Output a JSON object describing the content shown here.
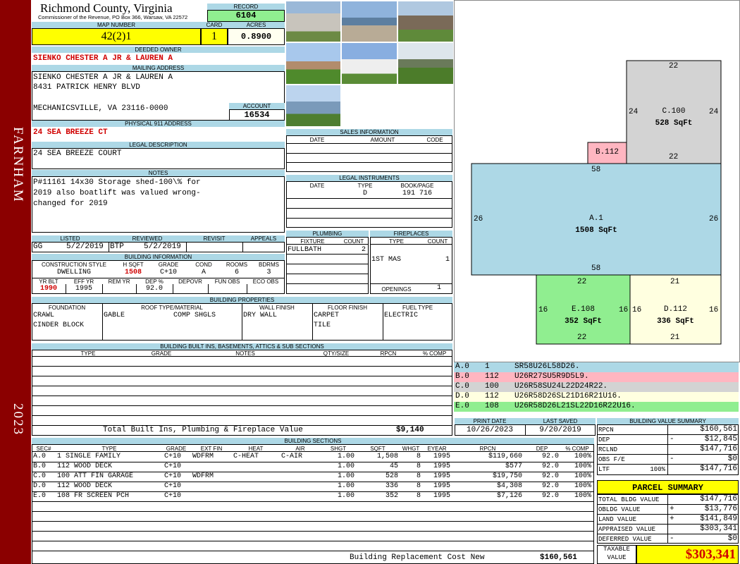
{
  "sidebar": {
    "district": "FARNHAM",
    "year": "2023"
  },
  "header": {
    "county": "Richmond County, Virginia",
    "commissioner": "Commissioner of the Revenue, PO Box 366, Warsaw, VA 22572"
  },
  "record": {
    "label": "RECORD",
    "value": "6104"
  },
  "map_number": {
    "label": "MAP NUMBER",
    "value": "42(2)1"
  },
  "card": {
    "label": "CARD",
    "value": "1"
  },
  "acres": {
    "label": "ACRES",
    "value": "0.8900"
  },
  "deeded_owner": {
    "label": "DEEDED OWNER",
    "value": "SIENKO CHESTER A JR & LAUREN A"
  },
  "mailing": {
    "label": "MAILING ADDRESS",
    "line1": "SIENKO CHESTER A JR & LAUREN A",
    "line2": "8431 PATRICK HENRY BLVD",
    "line3": "MECHANICSVILLE, VA 23116-0000"
  },
  "account": {
    "label": "ACCOUNT",
    "value": "16534"
  },
  "physical": {
    "label": "PHYSICAL 911 ADDRESS",
    "value": "24 SEA BREEZE CT"
  },
  "legal": {
    "label": "LEGAL DESCRIPTION",
    "value": "24 SEA BREEZE COURT"
  },
  "notes": {
    "label": "NOTES",
    "line1": "P#11161 14x30 Storage shed-100\\% for",
    "line2": "2019 also boatlift was valued wrong-",
    "line3": "changed for 2019"
  },
  "review": {
    "headers": [
      "LISTED",
      "REVIEWED",
      "REVISIT",
      "APPEALS"
    ],
    "listed_by": "GG",
    "listed_date": "5/2/2019",
    "reviewed_by": "BTP",
    "reviewed_date": "5/2/2019"
  },
  "building_info": {
    "label": "BUILDING INFORMATION",
    "headers": [
      "CONSTRUCTION STYLE",
      "H SQFT",
      "GRADE",
      "COND",
      "ROOMS",
      "BDRMS"
    ],
    "values": [
      "DWELLING",
      "1508",
      "C+10",
      "A",
      "6",
      "3"
    ],
    "headers2": [
      "YR BLT",
      "EFF YR",
      "REM YR",
      "DEP %",
      "DEPOVR",
      "FUN OBS",
      "ECO OBS"
    ],
    "values2": [
      "1990",
      "1995",
      "",
      "92.0",
      "",
      "",
      ""
    ]
  },
  "sales": {
    "label": "SALES INFORMATION",
    "headers": [
      "DATE",
      "AMOUNT",
      "CODE"
    ]
  },
  "legal_instruments": {
    "label": "LEGAL INSTRUMENTS",
    "headers": [
      "DATE",
      "TYPE",
      "BOOK/PAGE"
    ],
    "type": "D",
    "bookpage": "191 716"
  },
  "plumbing": {
    "label": "PLUMBING",
    "headers": [
      "FIXTURE",
      "COUNT"
    ],
    "fixture": "FULLBATH",
    "count": "2"
  },
  "fireplaces": {
    "label": "FIREPLACES",
    "headers": [
      "TYPE",
      "COUNT"
    ],
    "type": "1ST MAS",
    "count": "1",
    "openings_label": "OPENINGS",
    "openings": "1"
  },
  "building_properties": {
    "label": "BUILDING PROPERTIES",
    "headers": [
      "FOUNDATION",
      "ROOF TYPE/MATERIAL",
      "WALL FINISH",
      "FLOOR FINISH",
      "FUEL TYPE"
    ],
    "foundation1": "CRAWL",
    "foundation2": "CINDER BLOCK",
    "roof_type": "GABLE",
    "roof_material": "COMP SHGLS",
    "wall": "DRY WALL",
    "floor1": "CARPET",
    "floor2": "TILE",
    "fuel": "ELECTRIC"
  },
  "builtins": {
    "label": "BUILDING BUILT INS, BASEMENTS, ATTICS & SUB SECTIONS",
    "headers": [
      "TYPE",
      "GRADE",
      "NOTES",
      "QTY/SIZE",
      "RPCN",
      "% COMP"
    ],
    "total_label": "Total Built Ins, Plumbing & Fireplace Value",
    "total_value": "$9,140"
  },
  "sketch": {
    "sections": [
      {
        "id": "C.100",
        "sqft": "528 SqFt",
        "top": "22",
        "bottom": "22",
        "left": "24",
        "right": "24",
        "color": "#d3d3d3"
      },
      {
        "id": "B.112",
        "sqft": "",
        "color": "#ffb6c1"
      },
      {
        "id": "A.1",
        "sqft": "1508 SqFt",
        "top": "58",
        "bottom": "58",
        "left": "26",
        "right": "26",
        "color": "#add8e6"
      },
      {
        "id": "E.108",
        "sqft": "352 SqFt",
        "top": "22",
        "bottom": "22",
        "left": "16",
        "right": "16",
        "color": "#90ee90"
      },
      {
        "id": "D.112",
        "sqft": "336 SqFt",
        "top": "21",
        "bottom": "21",
        "left": "16",
        "right": "16",
        "color": "#ffffe0"
      }
    ],
    "legend": [
      {
        "sec": "A.0",
        "code": "1",
        "path": "SR58U26L58D26.",
        "color": "#add8e6"
      },
      {
        "sec": "B.0",
        "code": "112",
        "path": "U26R27SU5R9D5L9.",
        "color": "#ffb6c1"
      },
      {
        "sec": "C.0",
        "code": "100",
        "path": "U26R58SU24L22D24R22.",
        "color": "#d3d3d3"
      },
      {
        "sec": "D.0",
        "code": "112",
        "path": "U26R58D26SL21D16R21U16.",
        "color": "#ffffe0"
      },
      {
        "sec": "E.0",
        "code": "108",
        "path": "U26R58D26L21SL22D16R22U16.",
        "color": "#90ee90"
      }
    ]
  },
  "dates": {
    "print_label": "PRINT DATE",
    "print_value": "10/26/2023",
    "saved_label": "LAST SAVED",
    "saved_value": "9/20/2019"
  },
  "building_sections": {
    "label": "BUILDING SECTIONS",
    "headers": [
      "SEC#",
      "TYPE",
      "GRADE",
      "EXT FIN",
      "HEAT",
      "AIR",
      "SHGT",
      "SQFT",
      "WHGT",
      "EYEAR",
      "RPCN",
      "DEP",
      "% COMP"
    ],
    "rows": [
      [
        "A.0",
        "1 SINGLE FAMILY",
        "C+10",
        "WDFRM",
        "C-HEAT",
        "C-AIR",
        "1.00",
        "1,508",
        "8",
        "1995",
        "$119,660",
        "92.0",
        "100%"
      ],
      [
        "B.0",
        "112 WOOD DECK",
        "C+10",
        "",
        "",
        "",
        "1.00",
        "45",
        "8",
        "1995",
        "$577",
        "92.0",
        "100%"
      ],
      [
        "C.0",
        "100 ATT FIN GARAGE",
        "C+10",
        "WDFRM",
        "",
        "",
        "1.00",
        "528",
        "8",
        "1995",
        "$19,750",
        "92.0",
        "100%"
      ],
      [
        "D.0",
        "112 WOOD DECK",
        "C+10",
        "",
        "",
        "",
        "1.00",
        "336",
        "8",
        "1995",
        "$4,308",
        "92.0",
        "100%"
      ],
      [
        "E.0",
        "108 FR SCREEN PCH",
        "C+10",
        "",
        "",
        "",
        "1.00",
        "352",
        "8",
        "1995",
        "$7,126",
        "92.0",
        "100%"
      ]
    ],
    "replacement_label": "Building Replacement Cost New",
    "replacement_value": "$160,561"
  },
  "building_value_summary": {
    "label": "BUILDING VALUE SUMMARY",
    "rpcn_label": "RPCN",
    "rpcn": "$160,561",
    "dep_label": "DEP",
    "dep_sign": "-",
    "dep": "$12,845",
    "rclnd_label": "RCLND",
    "rclnd": "$147,716",
    "obs_label": "OBS F/E",
    "obs_sign": "-",
    "obs": "$0",
    "ltf_label": "LTF",
    "ltf_pct": "100%",
    "ltf": "$147,716"
  },
  "parcel_summary": {
    "label": "PARCEL SUMMARY",
    "total_bldg_label": "TOTAL BLDG VALUE",
    "total_bldg": "$147,716",
    "obldg_label": "OBLDG VALUE",
    "obldg_sign": "+",
    "obldg": "$13,776",
    "land_label": "LAND VALUE",
    "land_sign": "+",
    "land": "$141,849",
    "appraised_label": "APPRAISED VALUE",
    "appraised": "$303,341",
    "deferred_label": "DEFERRED VALUE",
    "deferred_sign": "-",
    "deferred": "$0",
    "taxable_label1": "TAXABLE",
    "taxable_label2": "VALUE",
    "taxable": "$303,341"
  }
}
